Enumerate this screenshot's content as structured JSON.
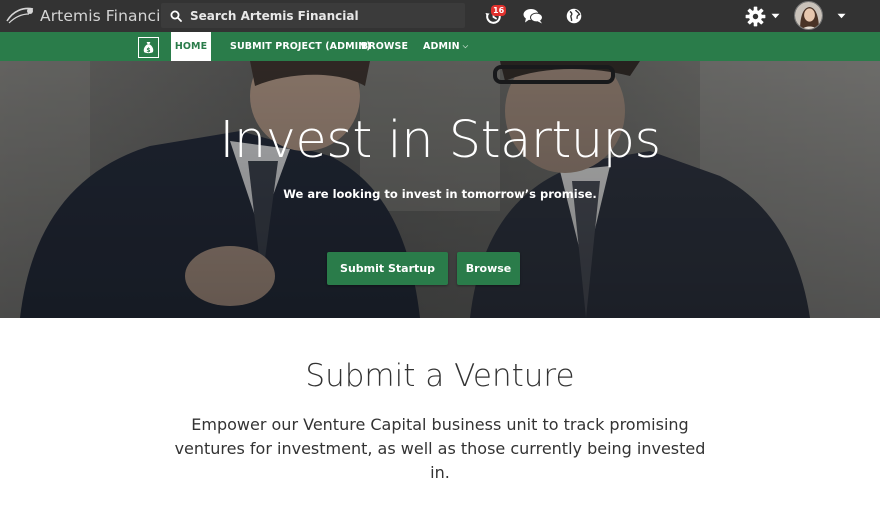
{
  "brand": {
    "name": "Artemis Financial"
  },
  "search": {
    "placeholder": "Search Artemis Financial"
  },
  "topbar": {
    "notifications_count": "16",
    "icons": [
      "history-icon",
      "chat-icon",
      "globe-icon",
      "gear-icon"
    ]
  },
  "nav": {
    "items": [
      {
        "label": "HOME",
        "active": true
      },
      {
        "label": "SUBMIT PROJECT (ADMIN)"
      },
      {
        "label": "BROWSE"
      },
      {
        "label": "ADMIN"
      }
    ]
  },
  "hero": {
    "title": "Invest in Startups",
    "subtitle": "We are looking to invest in tomorrow’s promise.",
    "primary_button": "Submit Startup",
    "secondary_button": "Browse"
  },
  "section": {
    "title": "Submit a Venture",
    "text": "Empower our Venture Capital business unit to track promising ventures for investment, as well as those currently being invested in."
  },
  "colors": {
    "topbar": "#333333",
    "accent_green": "#2a7c4a",
    "badge_red": "#e0312d",
    "text_dark": "#333333"
  }
}
